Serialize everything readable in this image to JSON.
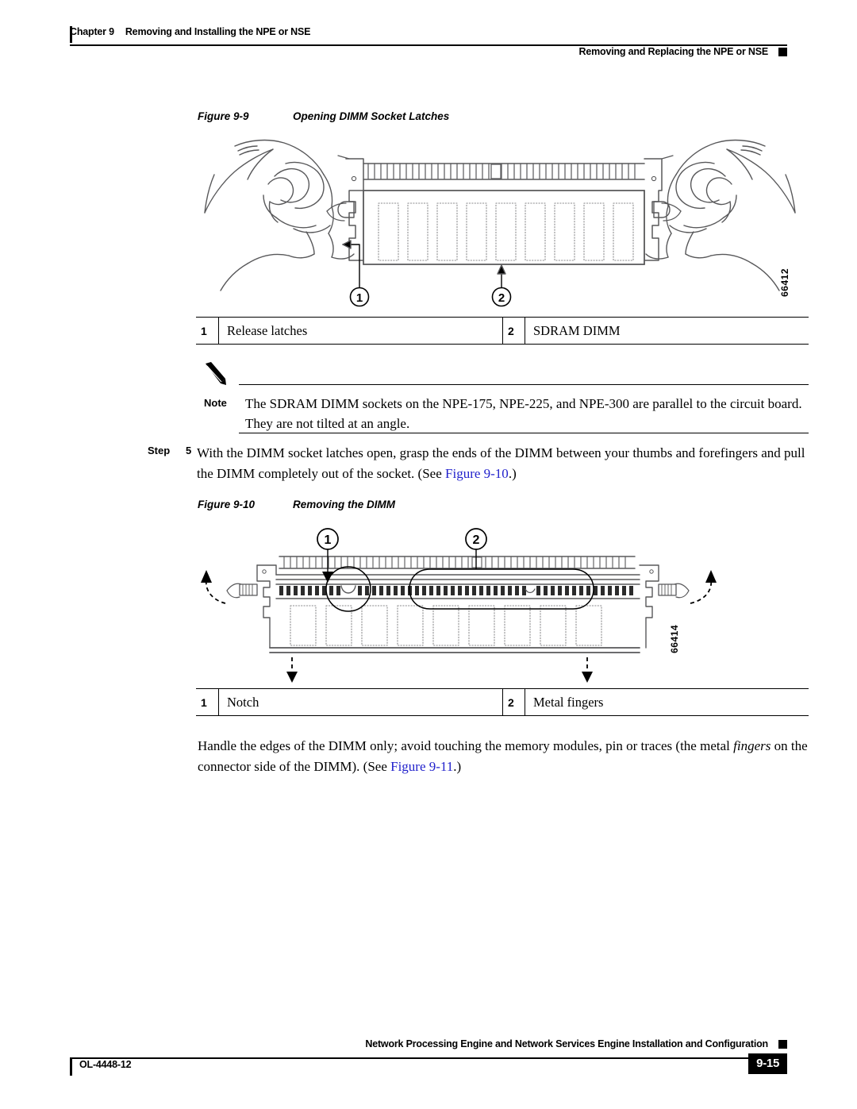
{
  "header": {
    "chapter_label": "Chapter 9",
    "chapter_title": "Removing and Installing the NPE or NSE",
    "section_title": "Removing and Replacing the NPE or NSE"
  },
  "figure_9_9": {
    "number": "Figure 9-9",
    "title": "Opening DIMM Socket Latches",
    "art_id": "66412",
    "callouts": [
      {
        "num": "1",
        "label": "Release latches"
      },
      {
        "num": "2",
        "label": "SDRAM DIMM"
      }
    ]
  },
  "note": {
    "label": "Note",
    "text": "The SDRAM DIMM sockets on the NPE-175, NPE-225, and NPE-300 are parallel to the circuit board. They are not tilted at an angle."
  },
  "step5": {
    "label": "Step",
    "number": "5",
    "text_part1": "With the DIMM socket latches open, grasp the ends of the DIMM between your thumbs and forefingers and pull the DIMM completely out of the socket. (See ",
    "xref": "Figure 9-10",
    "text_part2": ".)"
  },
  "figure_9_10": {
    "number": "Figure 9-10",
    "title": "Removing the DIMM",
    "art_id": "66414",
    "callouts": [
      {
        "num": "1",
        "label": "Notch"
      },
      {
        "num": "2",
        "label": "Metal fingers"
      }
    ]
  },
  "closing_para": {
    "text_part1": "Handle the edges of the DIMM only; avoid touching the memory modules, pin or traces (the metal ",
    "italic_word": "fingers",
    "text_part2": " on the connector side of the DIMM). (See ",
    "xref": "Figure 9-11",
    "text_part3": ".)"
  },
  "footer": {
    "doc_title": "Network Processing Engine and Network Services Engine Installation and Configuration",
    "doc_number": "OL-4448-12",
    "page_number": "9-15"
  },
  "colors": {
    "link": "#2222cc",
    "rule": "#000000",
    "art_line": "#58585a"
  }
}
